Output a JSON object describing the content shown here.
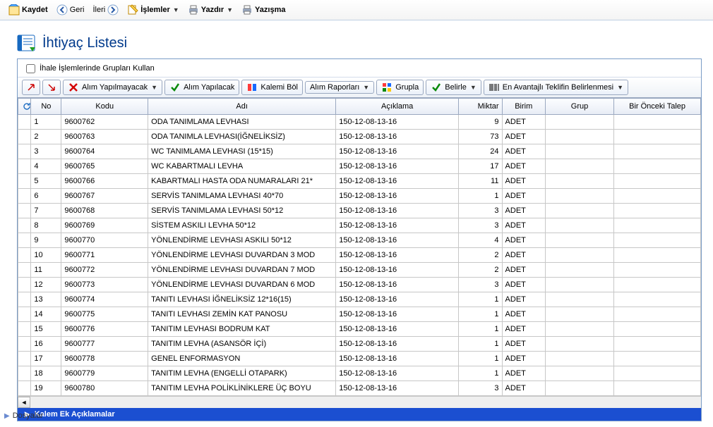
{
  "toolbar": {
    "kaydet": "Kaydet",
    "geri": "Geri",
    "ileri": "İleri",
    "islemler": "İşlemler",
    "yazdir": "Yazdır",
    "yazisma": "Yazışma"
  },
  "page": {
    "title": "İhtiyaç Listesi"
  },
  "options": {
    "ihale_gruplari": "İhale İşlemlerinde Grupları Kullan"
  },
  "buttons": {
    "alim_yapilmayacak": "Alım Yapılmayacak",
    "alim_yapilacak": "Alım Yapılacak",
    "kalemi_bol": "Kalemi Böl",
    "alim_raporlari": "Alım Raporları",
    "grupla": "Grupla",
    "belirle": "Belirle",
    "en_avantajli": "En Avantajlı Teklifin Belirlenmesi"
  },
  "columns": {
    "no": "No",
    "kodu": "Kodu",
    "adi": "Adı",
    "acik": "Açıklama",
    "miktar": "Miktar",
    "birim": "Birim",
    "grup": "Grup",
    "onceki": "Bir Önceki Talep"
  },
  "rows": [
    {
      "no": "1",
      "kodu": "9600762",
      "adi": "ODA TANIMLAMA LEVHASI",
      "acik": "150-12-08-13-16",
      "miktar": "9",
      "birim": "ADET"
    },
    {
      "no": "2",
      "kodu": "9600763",
      "adi": "ODA TANIMLA LEVHASI(İĞNELİKSİZ)",
      "acik": "150-12-08-13-16",
      "miktar": "73",
      "birim": "ADET"
    },
    {
      "no": "3",
      "kodu": "9600764",
      "adi": "WC TANIMLAMA LEVHASI (15*15)",
      "acik": "150-12-08-13-16",
      "miktar": "24",
      "birim": "ADET"
    },
    {
      "no": "4",
      "kodu": "9600765",
      "adi": "WC KABARTMALI LEVHA",
      "acik": "150-12-08-13-16",
      "miktar": "17",
      "birim": "ADET"
    },
    {
      "no": "5",
      "kodu": "9600766",
      "adi": "KABARTMALI HASTA ODA NUMARALARI 21*",
      "acik": "150-12-08-13-16",
      "miktar": "11",
      "birim": "ADET"
    },
    {
      "no": "6",
      "kodu": "9600767",
      "adi": "SERVİS TANIMLAMA LEVHASI 40*70",
      "acik": "150-12-08-13-16",
      "miktar": "1",
      "birim": "ADET"
    },
    {
      "no": "7",
      "kodu": "9600768",
      "adi": "SERVİS TANIMLAMA LEVHASI 50*12",
      "acik": "150-12-08-13-16",
      "miktar": "3",
      "birim": "ADET"
    },
    {
      "no": "8",
      "kodu": "9600769",
      "adi": "SİSTEM ASKILI LEVHA 50*12",
      "acik": "150-12-08-13-16",
      "miktar": "3",
      "birim": "ADET"
    },
    {
      "no": "9",
      "kodu": "9600770",
      "adi": "YÖNLENDİRME LEVHASI ASKILI 50*12",
      "acik": "150-12-08-13-16",
      "miktar": "4",
      "birim": "ADET"
    },
    {
      "no": "10",
      "kodu": "9600771",
      "adi": "YÖNLENDİRME LEVHASI DUVARDAN 3 MOD",
      "acik": "150-12-08-13-16",
      "miktar": "2",
      "birim": "ADET"
    },
    {
      "no": "11",
      "kodu": "9600772",
      "adi": "YÖNLENDİRME LEVHASI DUVARDAN 7 MOD",
      "acik": "150-12-08-13-16",
      "miktar": "2",
      "birim": "ADET"
    },
    {
      "no": "12",
      "kodu": "9600773",
      "adi": "YÖNLENDİRME LEVHASI DUVARDAN 6 MOD",
      "acik": "150-12-08-13-16",
      "miktar": "3",
      "birim": "ADET"
    },
    {
      "no": "13",
      "kodu": "9600774",
      "adi": "TANITI LEVHASI İĞNELİKSİZ 12*16(15)",
      "acik": "150-12-08-13-16",
      "miktar": "1",
      "birim": "ADET"
    },
    {
      "no": "14",
      "kodu": "9600775",
      "adi": "TANITI LEVHASI ZEMİN KAT PANOSU",
      "acik": "150-12-08-13-16",
      "miktar": "1",
      "birim": "ADET"
    },
    {
      "no": "15",
      "kodu": "9600776",
      "adi": "TANITIM LEVHASI BODRUM KAT",
      "acik": "150-12-08-13-16",
      "miktar": "1",
      "birim": "ADET"
    },
    {
      "no": "16",
      "kodu": "9600777",
      "adi": "TANITIM LEVHA (ASANSÖR İÇİ)",
      "acik": "150-12-08-13-16",
      "miktar": "1",
      "birim": "ADET"
    },
    {
      "no": "17",
      "kodu": "9600778",
      "adi": "GENEL ENFORMASYON",
      "acik": "150-12-08-13-16",
      "miktar": "1",
      "birim": "ADET"
    },
    {
      "no": "18",
      "kodu": "9600779",
      "adi": "TANITIM LEVHA (ENGELLİ OTAPARK)",
      "acik": "150-12-08-13-16",
      "miktar": "1",
      "birim": "ADET"
    },
    {
      "no": "19",
      "kodu": "9600780",
      "adi": "TANITIM LEVHA POLİKLİNİKLERE ÜÇ BOYU",
      "acik": "150-12-08-13-16",
      "miktar": "3",
      "birim": "ADET"
    }
  ],
  "collapser": {
    "label": "Kalem Ek Açıklamalar"
  },
  "footer": {
    "dosyalar": "Dosyalar"
  }
}
